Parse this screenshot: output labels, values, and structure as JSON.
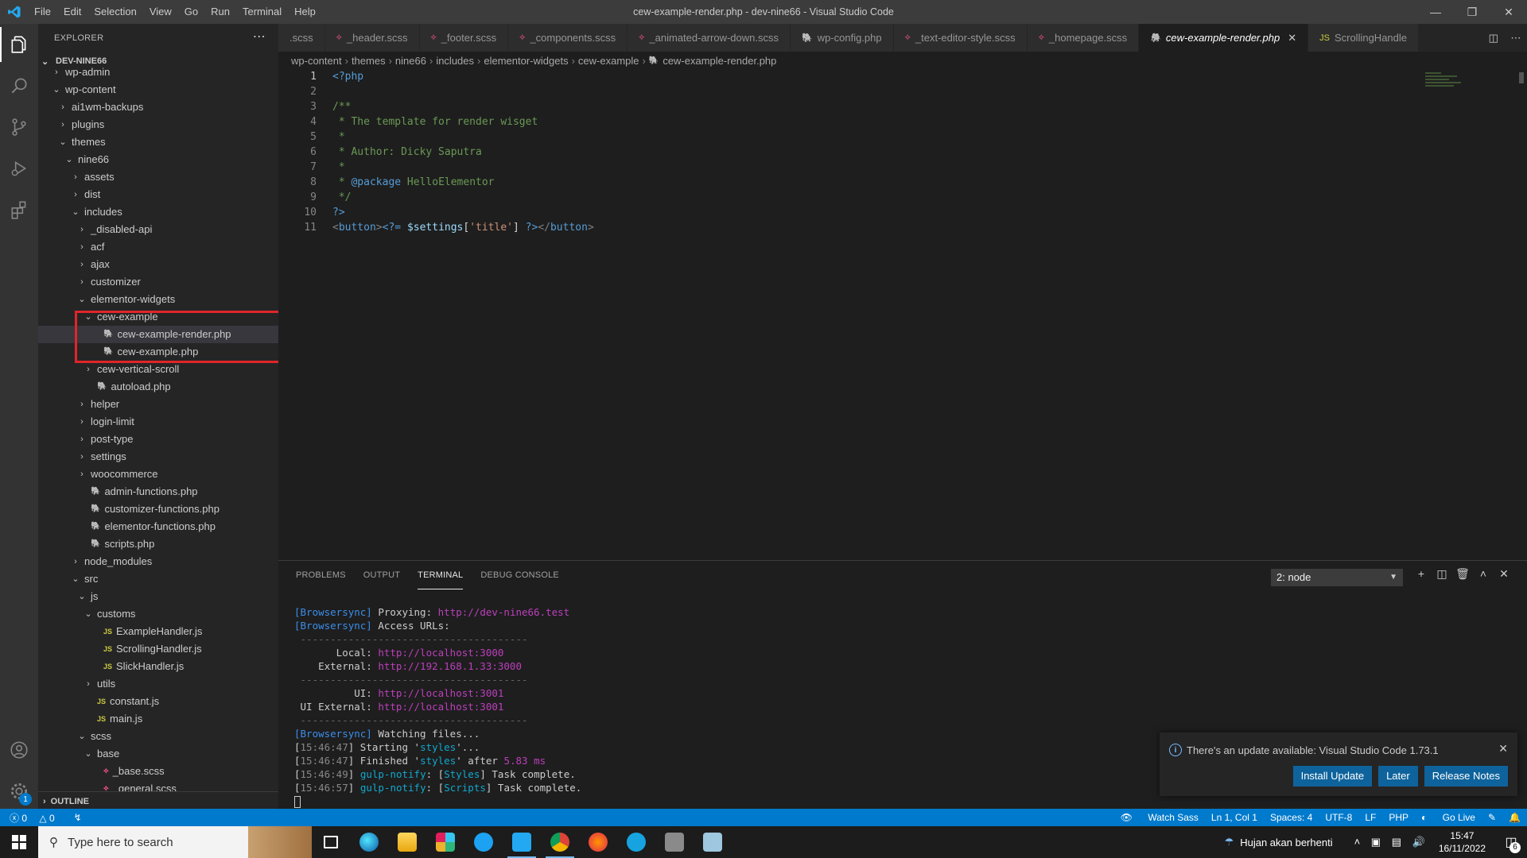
{
  "window": {
    "title": "cew-example-render.php - dev-nine66 - Visual Studio Code",
    "menu": [
      "File",
      "Edit",
      "Selection",
      "View",
      "Go",
      "Run",
      "Terminal",
      "Help"
    ]
  },
  "sidebar": {
    "header": "EXPLORER",
    "root": "DEV-NINE66",
    "outline": "OUTLINE",
    "tree": [
      {
        "label": "wp-admin",
        "depth": 1,
        "kind": "folder",
        "open": false
      },
      {
        "label": "wp-content",
        "depth": 1,
        "kind": "folder",
        "open": true
      },
      {
        "label": "ai1wm-backups",
        "depth": 2,
        "kind": "folder",
        "open": false
      },
      {
        "label": "plugins",
        "depth": 2,
        "kind": "folder",
        "open": false
      },
      {
        "label": "themes",
        "depth": 2,
        "kind": "folder",
        "open": true
      },
      {
        "label": "nine66",
        "depth": 3,
        "kind": "folder",
        "open": true
      },
      {
        "label": "assets",
        "depth": 4,
        "kind": "folder",
        "open": false
      },
      {
        "label": "dist",
        "depth": 4,
        "kind": "folder",
        "open": false
      },
      {
        "label": "includes",
        "depth": 4,
        "kind": "folder",
        "open": true
      },
      {
        "label": "_disabled-api",
        "depth": 5,
        "kind": "folder",
        "open": false
      },
      {
        "label": "acf",
        "depth": 5,
        "kind": "folder",
        "open": false
      },
      {
        "label": "ajax",
        "depth": 5,
        "kind": "folder",
        "open": false
      },
      {
        "label": "customizer",
        "depth": 5,
        "kind": "folder",
        "open": false
      },
      {
        "label": "elementor-widgets",
        "depth": 5,
        "kind": "folder",
        "open": true
      },
      {
        "label": "cew-example",
        "depth": 6,
        "kind": "folder",
        "open": true
      },
      {
        "label": "cew-example-render.php",
        "depth": 7,
        "kind": "php",
        "selected": true
      },
      {
        "label": "cew-example.php",
        "depth": 7,
        "kind": "php"
      },
      {
        "label": "cew-vertical-scroll",
        "depth": 6,
        "kind": "folder",
        "open": false
      },
      {
        "label": "autoload.php",
        "depth": 6,
        "kind": "php"
      },
      {
        "label": "helper",
        "depth": 5,
        "kind": "folder",
        "open": false
      },
      {
        "label": "login-limit",
        "depth": 5,
        "kind": "folder",
        "open": false
      },
      {
        "label": "post-type",
        "depth": 5,
        "kind": "folder",
        "open": false
      },
      {
        "label": "settings",
        "depth": 5,
        "kind": "folder",
        "open": false
      },
      {
        "label": "woocommerce",
        "depth": 5,
        "kind": "folder",
        "open": false
      },
      {
        "label": "admin-functions.php",
        "depth": 5,
        "kind": "php"
      },
      {
        "label": "customizer-functions.php",
        "depth": 5,
        "kind": "php"
      },
      {
        "label": "elementor-functions.php",
        "depth": 5,
        "kind": "php"
      },
      {
        "label": "scripts.php",
        "depth": 5,
        "kind": "php"
      },
      {
        "label": "node_modules",
        "depth": 4,
        "kind": "folder",
        "open": false
      },
      {
        "label": "src",
        "depth": 4,
        "kind": "folder",
        "open": true
      },
      {
        "label": "js",
        "depth": 5,
        "kind": "folder",
        "open": true
      },
      {
        "label": "customs",
        "depth": 6,
        "kind": "folder",
        "open": true
      },
      {
        "label": "ExampleHandler.js",
        "depth": 7,
        "kind": "js"
      },
      {
        "label": "ScrollingHandler.js",
        "depth": 7,
        "kind": "js"
      },
      {
        "label": "SlickHandler.js",
        "depth": 7,
        "kind": "js"
      },
      {
        "label": "utils",
        "depth": 6,
        "kind": "folder",
        "open": false
      },
      {
        "label": "constant.js",
        "depth": 6,
        "kind": "js"
      },
      {
        "label": "main.js",
        "depth": 6,
        "kind": "js"
      },
      {
        "label": "scss",
        "depth": 5,
        "kind": "folder",
        "open": true
      },
      {
        "label": "base",
        "depth": 6,
        "kind": "folder",
        "open": true
      },
      {
        "label": "_base.scss",
        "depth": 7,
        "kind": "scss"
      },
      {
        "label": "_general.scss",
        "depth": 7,
        "kind": "scss"
      }
    ]
  },
  "tabs": [
    {
      "label": ".scss",
      "kind": "scss"
    },
    {
      "label": "_header.scss",
      "kind": "scss"
    },
    {
      "label": "_footer.scss",
      "kind": "scss"
    },
    {
      "label": "_components.scss",
      "kind": "scss"
    },
    {
      "label": "_animated-arrow-down.scss",
      "kind": "scss"
    },
    {
      "label": "wp-config.php",
      "kind": "php"
    },
    {
      "label": "_text-editor-style.scss",
      "kind": "scss"
    },
    {
      "label": "_homepage.scss",
      "kind": "scss"
    },
    {
      "label": "cew-example-render.php",
      "kind": "php",
      "active": true
    },
    {
      "label": "ScrollingHandle",
      "kind": "js"
    }
  ],
  "breadcrumb": [
    "wp-content",
    "themes",
    "nine66",
    "includes",
    "elementor-widgets",
    "cew-example",
    "cew-example-render.php"
  ],
  "editor": {
    "line_numbers": [
      "1",
      "2",
      "3",
      "4",
      "5",
      "6",
      "7",
      "8",
      "9",
      "10",
      "11"
    ],
    "lines": [
      [
        [
          "php",
          "<?php"
        ]
      ],
      [],
      [
        [
          "com",
          "/**"
        ]
      ],
      [
        [
          "com",
          " * The template for render wisget"
        ]
      ],
      [
        [
          "com",
          " *"
        ]
      ],
      [
        [
          "com",
          " * Author: Dicky Saputra"
        ]
      ],
      [
        [
          "com",
          " *"
        ]
      ],
      [
        [
          "com",
          " * "
        ],
        [
          "kw",
          "@package"
        ],
        [
          "com",
          " HelloElementor"
        ]
      ],
      [
        [
          "com",
          " */"
        ]
      ],
      [
        [
          "php",
          "?>"
        ]
      ],
      [
        [
          "tag",
          "<"
        ],
        [
          "tagn",
          "button"
        ],
        [
          "tag",
          ">"
        ],
        [
          "php",
          "<?="
        ],
        [
          "punc",
          " "
        ],
        [
          "var",
          "$settings"
        ],
        [
          "punc",
          "["
        ],
        [
          "str",
          "'title'"
        ],
        [
          "punc",
          "] "
        ],
        [
          "php",
          "?>"
        ],
        [
          "tag",
          "</"
        ],
        [
          "tagn",
          "button"
        ],
        [
          "tag",
          ">"
        ]
      ]
    ]
  },
  "panel": {
    "tabs": [
      "PROBLEMS",
      "OUTPUT",
      "TERMINAL",
      "DEBUG CONSOLE"
    ],
    "active_tab": "TERMINAL",
    "terminal_select": "2: node",
    "terminal_lines": [
      [
        [
          "bs",
          "[Browsersync]"
        ],
        [
          "txt",
          " Proxying: "
        ],
        [
          "url",
          "http://dev-nine66.test"
        ]
      ],
      [
        [
          "bs",
          "[Browsersync]"
        ],
        [
          "txt",
          " Access URLs:"
        ]
      ],
      [
        [
          "dim",
          " --------------------------------------"
        ]
      ],
      [
        [
          "txt",
          "       Local: "
        ],
        [
          "url",
          "http://localhost:3000"
        ]
      ],
      [
        [
          "txt",
          "    External: "
        ],
        [
          "url",
          "http://192.168.1.33:3000"
        ]
      ],
      [
        [
          "dim",
          " --------------------------------------"
        ]
      ],
      [
        [
          "txt",
          "          UI: "
        ],
        [
          "url",
          "http://localhost:3001"
        ]
      ],
      [
        [
          "txt",
          " UI External: "
        ],
        [
          "url",
          "http://localhost:3001"
        ]
      ],
      [
        [
          "dim",
          " --------------------------------------"
        ]
      ],
      [
        [
          "bs",
          "[Browsersync]"
        ],
        [
          "txt",
          " Watching files..."
        ]
      ],
      [
        [
          "txt",
          "["
        ],
        [
          "time",
          "15:46:47"
        ],
        [
          "txt",
          "] Starting '"
        ],
        [
          "str",
          "styles"
        ],
        [
          "txt",
          "'..."
        ]
      ],
      [
        [
          "txt",
          "["
        ],
        [
          "time",
          "15:46:47"
        ],
        [
          "txt",
          "] Finished '"
        ],
        [
          "str",
          "styles"
        ],
        [
          "txt",
          "' after "
        ],
        [
          "num",
          "5.83 ms"
        ]
      ],
      [
        [
          "txt",
          "["
        ],
        [
          "time",
          "15:46:49"
        ],
        [
          "txt",
          "] "
        ],
        [
          "str",
          "gulp-notify"
        ],
        [
          "txt",
          ": ["
        ],
        [
          "str",
          "Styles"
        ],
        [
          "txt",
          "] Task complete."
        ]
      ],
      [
        [
          "txt",
          "["
        ],
        [
          "time",
          "15:46:57"
        ],
        [
          "txt",
          "] "
        ],
        [
          "str",
          "gulp-notify"
        ],
        [
          "txt",
          ": ["
        ],
        [
          "str",
          "Scripts"
        ],
        [
          "txt",
          "] Task complete."
        ]
      ]
    ]
  },
  "notification": {
    "message": "There's an update available: Visual Studio Code 1.73.1",
    "buttons": [
      "Install Update",
      "Later",
      "Release Notes"
    ]
  },
  "statusbar": {
    "errors": "0",
    "warnings": "0",
    "watch_sass": "Watch Sass",
    "position": "Ln 1, Col 1",
    "spaces": "Spaces: 4",
    "encoding": "UTF-8",
    "eol": "LF",
    "language": "PHP",
    "go_live": "Go Live"
  },
  "taskbar": {
    "search_placeholder": "Type here to search",
    "weather": "Hujan akan berhenti",
    "time": "15:47",
    "date": "16/11/2022",
    "notification_count": "6"
  },
  "colors": {
    "accent": "#007acc",
    "highlight_box": "#e0252a"
  }
}
